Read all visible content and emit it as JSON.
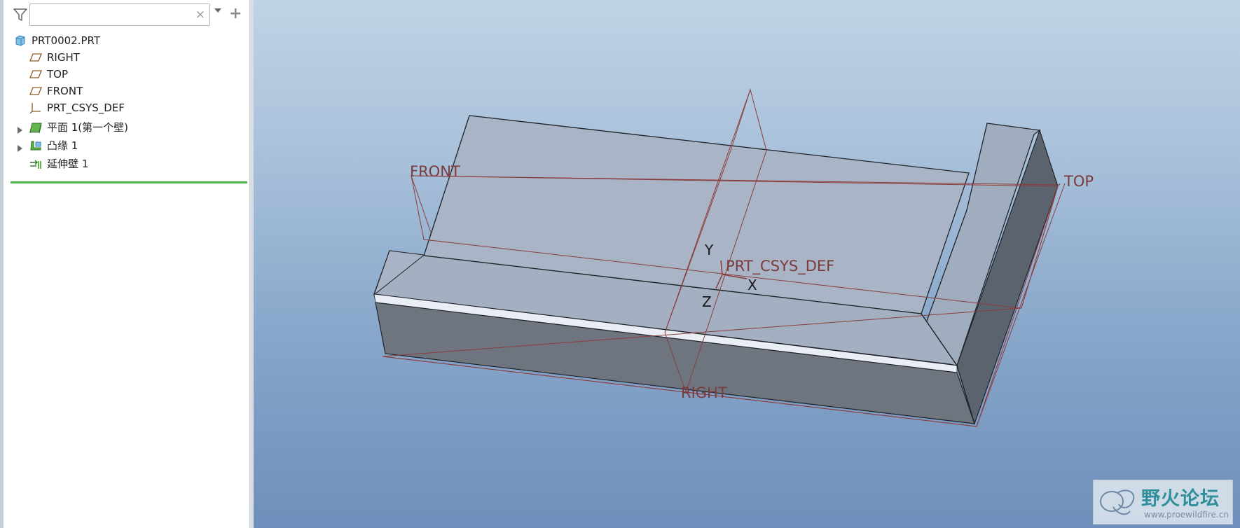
{
  "model_tree": {
    "search": {
      "value": "",
      "placeholder": "",
      "clear_glyph": "×"
    },
    "icons": {
      "filter": "filter-icon",
      "dropdown": "dropdown-icon",
      "add": "add-icon"
    },
    "items": [
      {
        "label": "PRT0002.PRT",
        "icon": "part-icon",
        "expandable": false
      },
      {
        "label": "RIGHT",
        "icon": "datum-plane-icon",
        "expandable": false
      },
      {
        "label": "TOP",
        "icon": "datum-plane-icon",
        "expandable": false
      },
      {
        "label": "FRONT",
        "icon": "datum-plane-icon",
        "expandable": false
      },
      {
        "label": "PRT_CSYS_DEF",
        "icon": "coordinate-system-icon",
        "expandable": false
      },
      {
        "label": "平面 1(第一个壁)",
        "icon": "planar-wall-icon",
        "expandable": true
      },
      {
        "label": "凸缘 1",
        "icon": "flange-wall-icon",
        "expandable": true
      },
      {
        "label": "延伸壁 1",
        "icon": "extend-wall-icon",
        "expandable": false
      }
    ],
    "insert_marker_color": "#47b548"
  },
  "viewport": {
    "datum_labels": {
      "front": "FRONT",
      "top": "TOP",
      "right": "RIGHT",
      "csys": "PRT_CSYS_DEF"
    },
    "axis_labels": {
      "x": "X",
      "y": "Y",
      "z": "Z"
    },
    "colors": {
      "datum": "#8a3d3d",
      "background_top": "#c0d3e6",
      "background_bottom": "#6e8fbb",
      "part_top": "#a7b3c4",
      "part_side": "#70767f"
    }
  },
  "watermark": {
    "title": "野火论坛",
    "url": "www.proewildfire.cn"
  }
}
